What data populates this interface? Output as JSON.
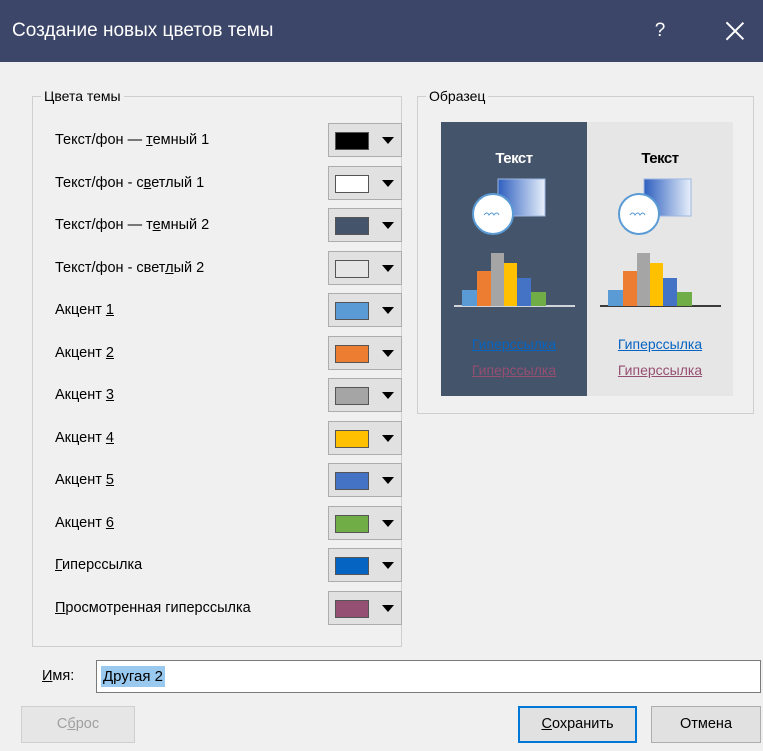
{
  "dialog": {
    "title": "Создание новых цветов темы",
    "help": "?"
  },
  "theme_colors": {
    "group_label": "Цвета темы",
    "items": [
      {
        "label_pre": "Текст/фон — ",
        "label_key": "т",
        "label_post": "емный 1",
        "color": "#000000"
      },
      {
        "label_pre": "Текст/фон - с",
        "label_key": "в",
        "label_post": "етлый 1",
        "color": "#ffffff"
      },
      {
        "label_pre": "Текст/фон — т",
        "label_key": "е",
        "label_post": "мный 2",
        "color": "#44546a"
      },
      {
        "label_pre": "Текст/фон - свет",
        "label_key": "л",
        "label_post": "ый 2",
        "color": "#e7e6e6"
      },
      {
        "label_pre": "Акцент ",
        "label_key": "1",
        "label_post": "",
        "color": "#5b9bd5"
      },
      {
        "label_pre": "Акцент ",
        "label_key": "2",
        "label_post": "",
        "color": "#ed7d31"
      },
      {
        "label_pre": "Акцент ",
        "label_key": "3",
        "label_post": "",
        "color": "#a5a5a5"
      },
      {
        "label_pre": "Акцент ",
        "label_key": "4",
        "label_post": "",
        "color": "#ffc000"
      },
      {
        "label_pre": "Акцент ",
        "label_key": "5",
        "label_post": "",
        "color": "#4472c4"
      },
      {
        "label_pre": "Акцент ",
        "label_key": "6",
        "label_post": "",
        "color": "#70ad47"
      },
      {
        "label_pre": "",
        "label_key": "Г",
        "label_post": "иперссылка",
        "color": "#0563c1"
      },
      {
        "label_pre": "",
        "label_key": "П",
        "label_post": "росмотренная гиперссылка",
        "color": "#954f72"
      }
    ]
  },
  "sample": {
    "group_label": "Образец",
    "text": "Текст",
    "hyperlink": "Гиперссылка",
    "followed_hyperlink": "Гиперссылка"
  },
  "name_field": {
    "label_key": "И",
    "label_post": "мя:",
    "value": "Другая 2"
  },
  "buttons": {
    "reset_pre": "С",
    "reset_key": "б",
    "reset_post": "рос",
    "save_key": "С",
    "save_post": "охранить",
    "cancel": "Отмена"
  }
}
